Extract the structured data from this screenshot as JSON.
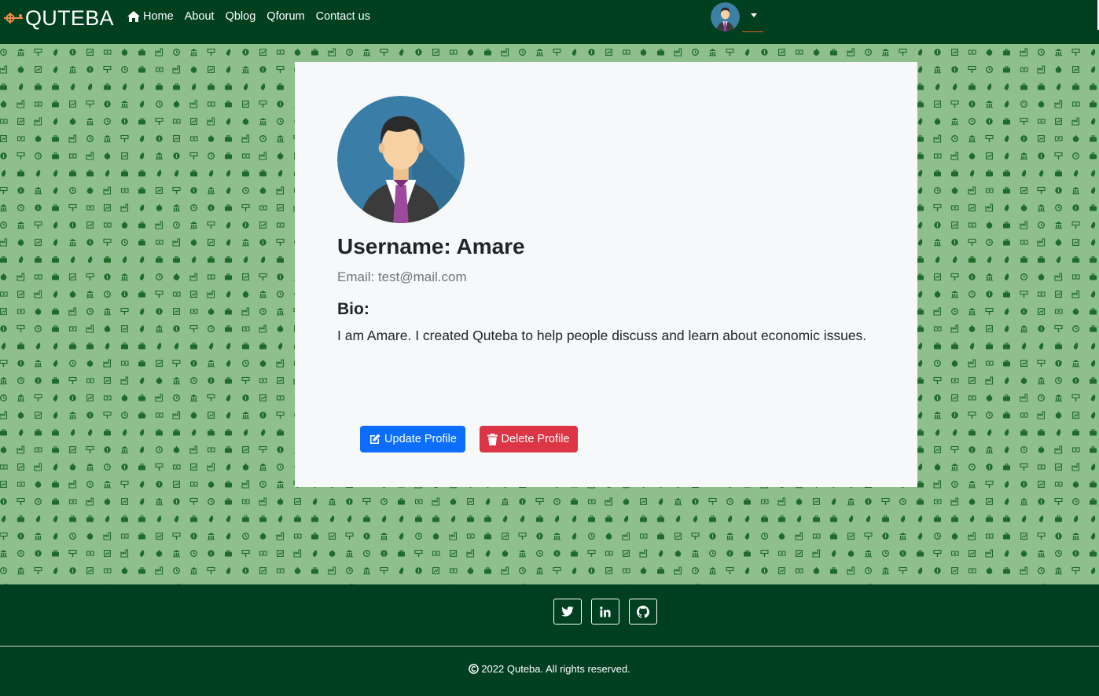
{
  "navbar": {
    "brand": "QUTEBA",
    "links": [
      {
        "label": "Home",
        "icon": "home-icon"
      },
      {
        "label": "About"
      },
      {
        "label": "Qblog"
      },
      {
        "label": "Qforum"
      },
      {
        "label": "Contact us"
      }
    ]
  },
  "profile": {
    "username": "Username: Amare",
    "email": "Email: test@mail.com",
    "bio_heading": "Bio:",
    "bio_text": "I am Amare. I created Quteba to help people discuss and learn about economic issues.",
    "update_label": "Update Profile",
    "delete_label": "Delete Profile"
  },
  "footer": {
    "social": [
      "twitter-icon",
      "linkedin-icon",
      "github-icon"
    ],
    "copyright": "2022 Quteba. All rights reserved."
  },
  "colors": {
    "nav_bg": "#00401f",
    "pattern_bg": "#8fbf8c",
    "pattern_icon": "#1f6b2a",
    "primary": "#0d6efd",
    "danger": "#dc3545"
  }
}
